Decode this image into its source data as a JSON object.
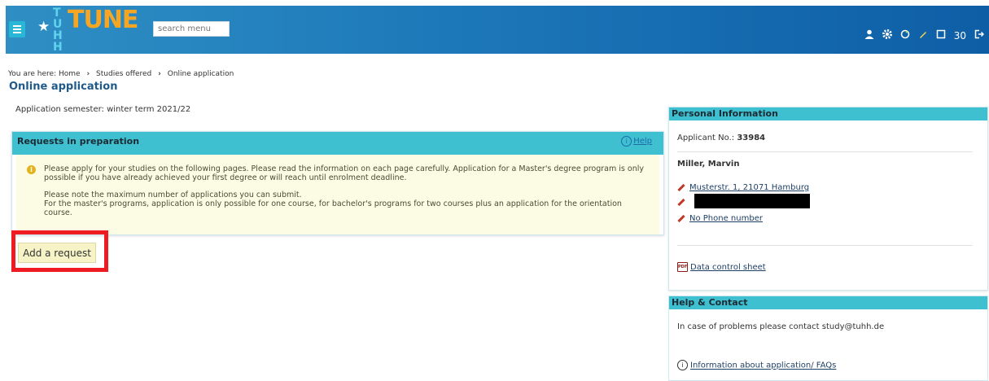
{
  "header": {
    "logo_side": "TUHH",
    "logo_main": "TUNE",
    "search_placeholder": "search menu",
    "session_counter": "30"
  },
  "breadcrumb": {
    "prefix": "You are here:",
    "items": [
      "Home",
      "Studies offered",
      "Online application"
    ]
  },
  "page_title": "Online application",
  "semester_text": "Application semester: winter term 2021/22",
  "requests": {
    "title": "Requests in preparation",
    "help_label": "Help",
    "paragraph1": "Please apply for your studies on the following pages. Please read the information on each page carefully. Application for a Master's degree program is only possible if you have already achieved your first degree or will reach until enrolment deadline.",
    "paragraph2_line1": "Please note the maximum number of applications you can submit.",
    "paragraph2_line2": "For the master's programs, application is only possible for one course, for bachelor's programs for two courses plus an application for the orientation course."
  },
  "add_request_label": "Add a request",
  "personal_info": {
    "title": "Personal Information",
    "applicant_label": "Applicant No.:",
    "applicant_no": "33984",
    "name": "Miller, Marvin",
    "address": "Musterstr. 1, 21071 Hamburg",
    "phone": "No Phone number",
    "data_sheet": "Data control sheet"
  },
  "help_contact": {
    "title": "Help & Contact",
    "text": "In case of problems please contact  study@tuhh.de",
    "faq_link": "Information about application/ FAQs"
  }
}
